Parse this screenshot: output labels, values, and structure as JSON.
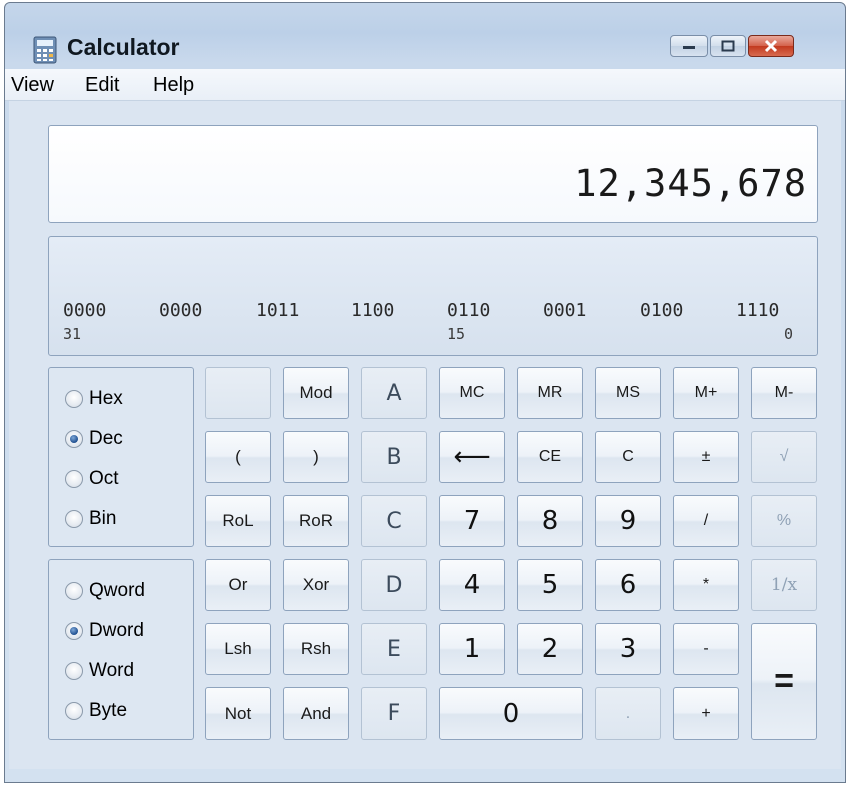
{
  "window": {
    "title": "Calculator",
    "controls": [
      "minimize",
      "maximize",
      "close"
    ]
  },
  "menu": [
    "View",
    "Edit",
    "Help"
  ],
  "display": {
    "value": "12,345,678"
  },
  "binary": {
    "nibbles": [
      "0000",
      "0000",
      "1011",
      "1100",
      "0110",
      "0001",
      "0100",
      "1110"
    ],
    "bit_labels": [
      "31",
      "15",
      "0"
    ]
  },
  "base_options": [
    {
      "label": "Hex",
      "selected": false
    },
    {
      "label": "Dec",
      "selected": true
    },
    {
      "label": "Oct",
      "selected": false
    },
    {
      "label": "Bin",
      "selected": false
    }
  ],
  "word_options": [
    {
      "label": "Qword",
      "selected": false
    },
    {
      "label": "Dword",
      "selected": true
    },
    {
      "label": "Word",
      "selected": false
    },
    {
      "label": "Byte",
      "selected": false
    }
  ],
  "keys": {
    "blank": "",
    "mod": "Mod",
    "a": "A",
    "mc": "MC",
    "mr": "MR",
    "ms": "MS",
    "mplus": "M+",
    "mminus": "M-",
    "lparen": "(",
    "rparen": ")",
    "b": "B",
    "backspace": "⟵",
    "ce": "CE",
    "c": "C",
    "plusminus": "±",
    "sqrt": "√",
    "rol": "RoL",
    "ror": "RoR",
    "hex_c": "C",
    "seven": "7",
    "eight": "8",
    "nine": "9",
    "divide": "/",
    "percent": "%",
    "or": "Or",
    "xor": "Xor",
    "d": "D",
    "four": "4",
    "five": "5",
    "six": "6",
    "multiply": "*",
    "reciprocal": "1/x",
    "lsh": "Lsh",
    "rsh": "Rsh",
    "e": "E",
    "one": "1",
    "two": "2",
    "three": "3",
    "minus": "-",
    "equals": "=",
    "not": "Not",
    "and": "And",
    "f": "F",
    "zero": "0",
    "decimal": ".",
    "plus": "+"
  },
  "colors": {
    "frame": "#c5d6ea",
    "client": "#dbe5f1",
    "button_border": "#8ea3bd",
    "close_red": "#c2391f"
  }
}
